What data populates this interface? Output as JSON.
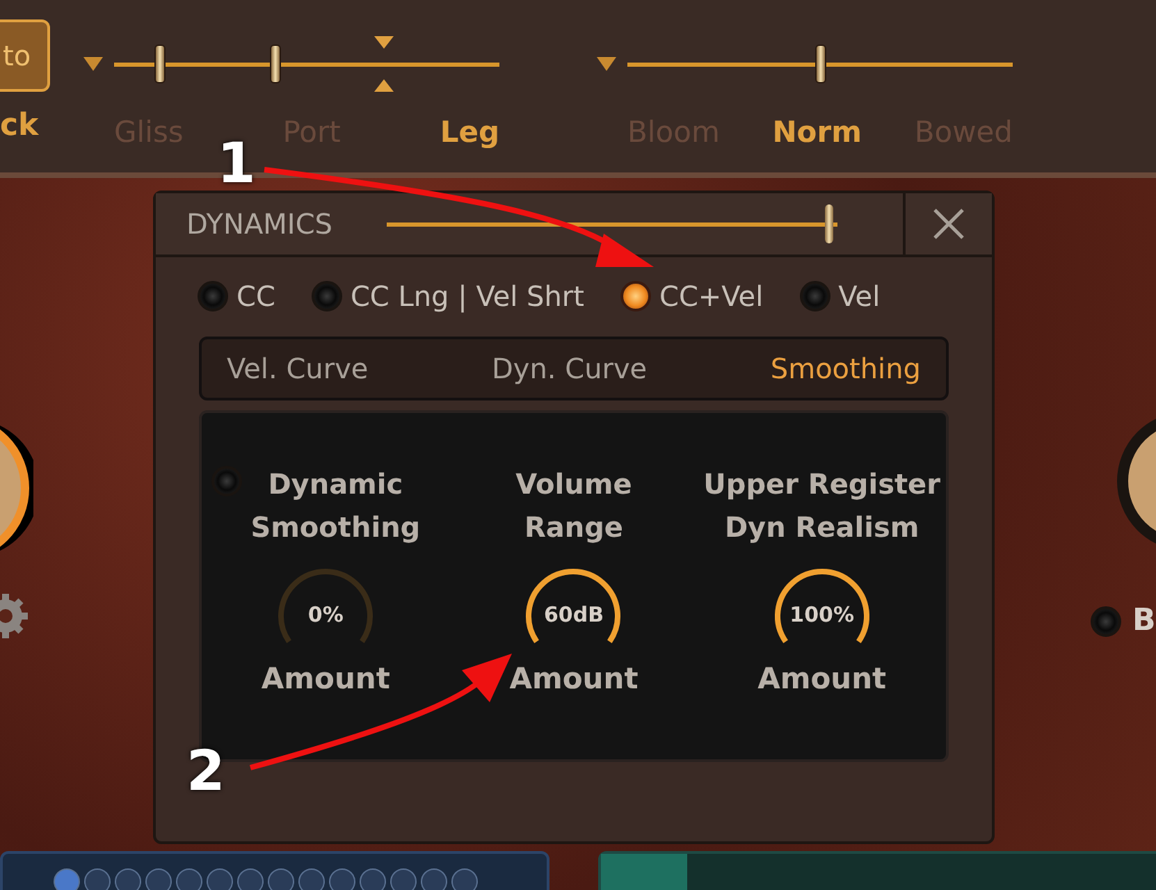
{
  "top_bar": {
    "left_button": {
      "label": "to",
      "selected": true
    },
    "left_label": "ck",
    "articulation_slider": {
      "thumbs": [
        {
          "level": 0.12
        },
        {
          "level": 0.42
        }
      ],
      "marker": {
        "level": 0.7
      },
      "labels": [
        {
          "label": "Gliss",
          "selected": false
        },
        {
          "label": "Port",
          "selected": false
        },
        {
          "label": "Leg",
          "selected": true
        }
      ]
    },
    "tone_slider": {
      "thumbs": [
        {
          "level": 0.5
        }
      ],
      "labels": [
        {
          "label": "Bloom",
          "selected": false
        },
        {
          "label": "Norm",
          "selected": true
        },
        {
          "label": "Bowed",
          "selected": false
        }
      ]
    }
  },
  "right_side": {
    "radio": {
      "selected": false
    },
    "label": "B"
  },
  "dialog": {
    "title": "DYNAMICS",
    "slider": {
      "level": 0.98
    },
    "modes": [
      {
        "label": "CC",
        "selected": false
      },
      {
        "label": "CC Lng | Vel Shrt",
        "selected": false
      },
      {
        "label": "CC+Vel",
        "selected": true
      },
      {
        "label": "Vel",
        "selected": false
      }
    ],
    "tabs": [
      {
        "label": "Vel. Curve",
        "selected": false
      },
      {
        "label": "Dyn. Curve",
        "selected": false
      },
      {
        "label": "Smoothing",
        "selected": true
      }
    ],
    "controls": [
      {
        "title": [
          "Dynamic",
          "Smoothing"
        ],
        "toggle": {
          "on": false
        },
        "value": "0%",
        "level": 0,
        "caption": "Amount"
      },
      {
        "title": [
          "Volume",
          "Range"
        ],
        "value": "60dB",
        "level": 1,
        "caption": "Amount"
      },
      {
        "title": [
          "Upper Register",
          "Dyn Realism"
        ],
        "value": "100%",
        "level": 1,
        "caption": "Amount"
      }
    ]
  },
  "annotations": [
    {
      "label": "1"
    },
    {
      "label": "2"
    }
  ]
}
